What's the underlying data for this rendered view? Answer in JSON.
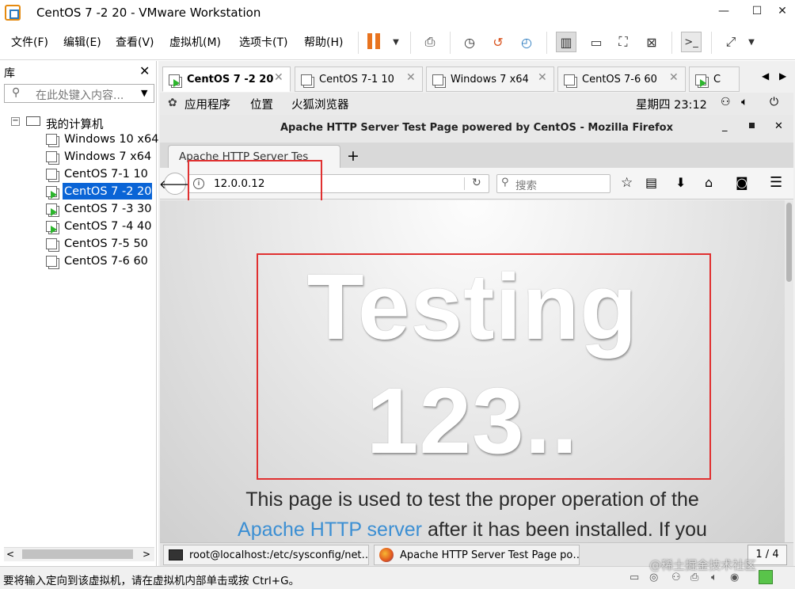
{
  "window": {
    "title": "CentOS 7 -2 20 - VMware Workstation",
    "controls": [
      "—",
      "☐",
      "✕"
    ]
  },
  "menubar": {
    "items": [
      "文件(F)",
      "编辑(E)",
      "查看(V)",
      "虚拟机(M)",
      "选项卡(T)",
      "帮助(H)"
    ]
  },
  "toolbar": {
    "accent": "#e8731f"
  },
  "library": {
    "title": "库",
    "close": "✕",
    "search_placeholder": "在此处键入内容...",
    "root": "我的计算机",
    "vms": [
      {
        "name": "Windows 10 x64",
        "running": false
      },
      {
        "name": "Windows 7 x64",
        "running": false
      },
      {
        "name": "CentOS 7-1  10",
        "running": false
      },
      {
        "name": "CentOS 7 -2 20",
        "running": true,
        "selected": true
      },
      {
        "name": "CentOS 7 -3 30",
        "running": true
      },
      {
        "name": "CentOS 7 -4 40",
        "running": true
      },
      {
        "name": "CentOS 7-5 50",
        "running": false
      },
      {
        "name": "CentOS 7-6  60",
        "running": false
      }
    ]
  },
  "vm_tabs": [
    {
      "label": "CentOS 7 -2 20",
      "active": true
    },
    {
      "label": "CentOS 7-1  10",
      "active": false
    },
    {
      "label": "Windows 7 x64",
      "active": false
    },
    {
      "label": "CentOS 7-6  60",
      "active": false
    },
    {
      "label": "C",
      "active": false
    }
  ],
  "gnome": {
    "apps": "应用程序",
    "places": "位置",
    "browser": "火狐浏览器",
    "clock": "星期四 23:12"
  },
  "firefox": {
    "title": "Apache HTTP Server Test Page powered by CentOS - Mozilla Firefox",
    "tab": "Apache HTTP Server Tes",
    "new_tab": "+",
    "url": "12.0.0.12",
    "search_placeholder": "搜索"
  },
  "page": {
    "heading1": "Testing",
    "heading2": "123..",
    "line1": "This page is used to test the proper operation of the",
    "link": "Apache HTTP server",
    "line2_rest": " after it has been installed. If you",
    "link_color": "#3c8fd3"
  },
  "taskbar": {
    "terminal": "root@localhost:/etc/sysconfig/net…",
    "firefox": "Apache HTTP Server Test Page po…",
    "pager": "1 / 4"
  },
  "status": {
    "text": "要将输入定向到该虚拟机，请在虚拟机内部单击或按 Ctrl+G。",
    "watermark": "@稀土掘金技术社区"
  }
}
